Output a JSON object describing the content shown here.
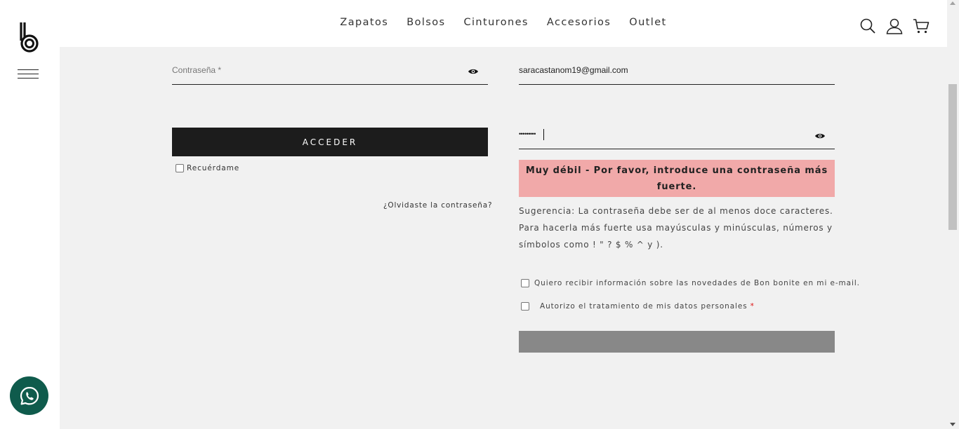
{
  "nav": {
    "items": [
      "Zapatos",
      "Bolsos",
      "Cinturones",
      "Accesorios",
      "Outlet"
    ]
  },
  "header_icons": [
    "search-icon",
    "user-icon",
    "cart-icon"
  ],
  "left_rail": {
    "logo": "b-logo",
    "menu_icon": "hamburger-menu-icon",
    "chat_icon": "whatsapp-icon"
  },
  "login": {
    "password_placeholder": "Contraseña *",
    "submit_label": "ACCEDER",
    "remember_label": "Recuérdame",
    "forgot_label": "¿Olvidaste la contraseña?"
  },
  "register": {
    "email_value": "saracastanom19@gmail.com",
    "password_masked": "•••••••••",
    "strength_message": "Muy débil - Por favor, introduce una contraseña más fuerte.",
    "hint": "Sugerencia: La contraseña debe ser de al menos doce caracteres. Para hacerla más fuerte usa mayúsculas y minúsculas, números y símbolos como ! \" ? $ % ^ y ).",
    "newsletter_label": "Quiero recibir información sobre las novedades de Bon bonite en mi e-mail.",
    "privacy_label": "Autorizo el tratamiento de mis datos personales",
    "required_mark": "*",
    "submit_label": ""
  },
  "colors": {
    "background": "#f1f1f1",
    "button_dark": "#1c1c1c",
    "strength_bg": "#f1a9a9",
    "submit_disabled": "#888888",
    "whatsapp": "#0f5b4c"
  }
}
